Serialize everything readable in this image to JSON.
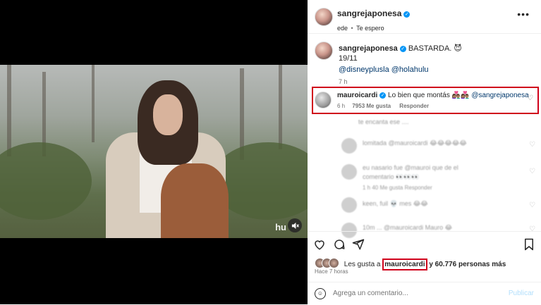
{
  "video": {
    "logo_text": "hu"
  },
  "header": {
    "username": "sangrejaponesa",
    "subtitle_left": "ede",
    "subtitle_sep": "•",
    "subtitle_song": "Te espero"
  },
  "caption": {
    "username": "sangrejaponesa",
    "text": "BASTARDA. 😈",
    "date": "19/11",
    "mentions": "@disneyplusla @holahulu",
    "age": "7 h"
  },
  "highlight_comment": {
    "username": "mauroicardi",
    "text": "Lo bien que montás 👩🏽‍❤️‍👨🏽👩🏽‍❤️‍👨🏽",
    "mention": "@sangrejaponesa",
    "age": "6 h",
    "likes": "7953 Me gusta",
    "reply": "Responder"
  },
  "blurred_comments": [
    {
      "text": "te encanta ese ...."
    },
    {
      "text": "lomitada @mauroicardi 😂😂😂😂😂"
    },
    {
      "text": "eu nasario fue @mauroi que de el"
    },
    {
      "text": "comentario 👀👀👀"
    },
    {
      "text": "1 h   40 Me gusta   Responder"
    },
    {
      "text": "keen, fuil 💀 mes 😂😂"
    },
    {
      "text": "10m  ... @mauroicardi Mauro 😂"
    }
  ],
  "likes": {
    "prefix": "Les gusta a",
    "user": "mauroicardi",
    "suffix": "y 60.776 personas más"
  },
  "post_time": "Hace 7 horas",
  "comment_box": {
    "placeholder": "Agrega un comentario...",
    "publish": "Publicar"
  }
}
